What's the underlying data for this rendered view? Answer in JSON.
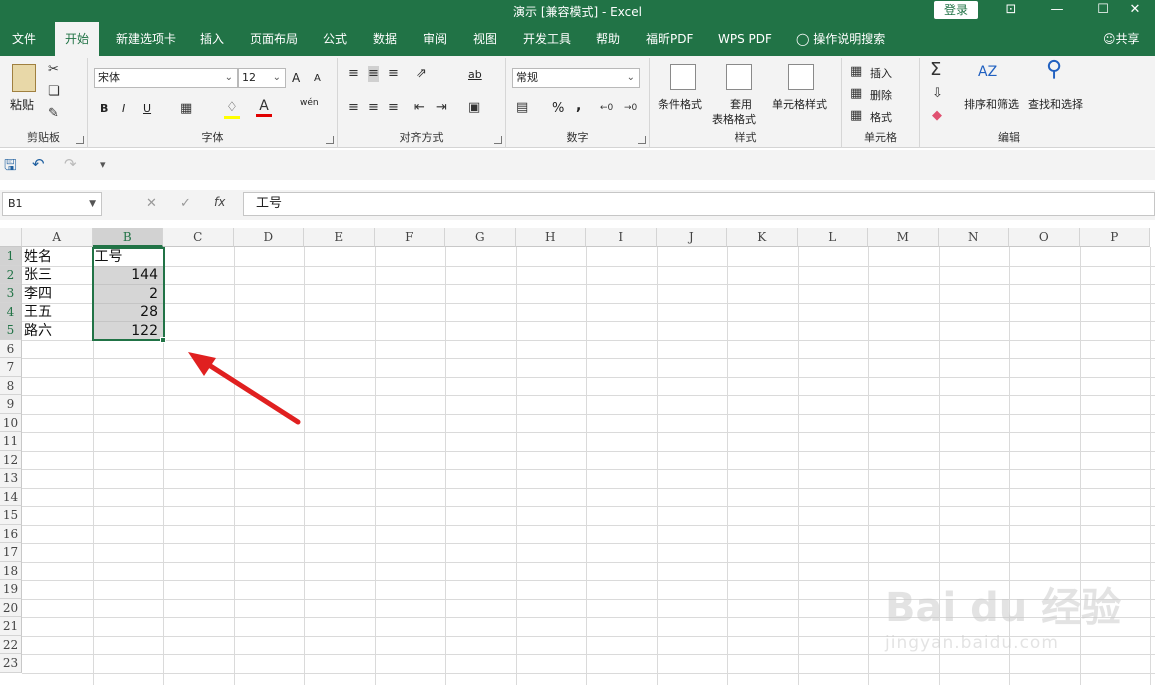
{
  "window": {
    "title": "演示 [兼容模式] - Excel",
    "login": "登录",
    "controls": [
      "⊡",
      "—",
      "☐",
      "✕"
    ]
  },
  "menu": {
    "tabs": [
      "文件",
      "开始",
      "新建选项卡",
      "插入",
      "页面布局",
      "公式",
      "数据",
      "审阅",
      "视图",
      "开发工具",
      "帮助",
      "福昕PDF",
      "WPS PDF"
    ],
    "active": "开始",
    "tell_me": "操作说明搜索",
    "share": "共享"
  },
  "ribbon": {
    "clipboard": {
      "label": "剪贴板",
      "paste": "粘贴"
    },
    "font": {
      "label": "字体",
      "font_name": "宋体",
      "font_size": "12",
      "bold": "B",
      "italic": "I",
      "underline": "U",
      "grow": "A",
      "shrink": "A",
      "wen": "wén"
    },
    "alignment": {
      "label": "对齐方式",
      "wrap": "ab"
    },
    "number": {
      "label": "数字",
      "format": "常规",
      "percent": "%",
      "comma": ","
    },
    "styles": {
      "label": "样式",
      "conditional": "条件格式",
      "table_line1": "套用",
      "table_line2": "表格格式",
      "cell_styles": "单元格样式"
    },
    "cells": {
      "label": "单元格",
      "insert": "插入",
      "delete": "删除",
      "format": "格式"
    },
    "editing": {
      "label": "编辑",
      "sort": "排序和筛选",
      "find": "查找和选择"
    }
  },
  "formula_bar": {
    "name_box": "B1",
    "fx": "fx",
    "content": "工号"
  },
  "sheet": {
    "columns": [
      "A",
      "B",
      "C",
      "D",
      "E",
      "F",
      "G",
      "H",
      "I",
      "J",
      "K",
      "L",
      "M",
      "N",
      "O",
      "P"
    ],
    "rows": [
      "1",
      "2",
      "3",
      "4",
      "5",
      "6",
      "7",
      "8",
      "9",
      "10",
      "11",
      "12",
      "13",
      "14",
      "15",
      "16",
      "17",
      "18",
      "19",
      "20",
      "21",
      "22",
      "23"
    ],
    "cells": {
      "A1": "姓名",
      "B1": "工号",
      "A2": "张三",
      "B2": "144",
      "A3": "李四",
      "B3": "2",
      "A4": "王五",
      "B4": "28",
      "A5": "路六",
      "B5": "122"
    },
    "selection": "B1:B5"
  },
  "watermark": {
    "brand": "Bai du 经验",
    "url": "jingyan.baidu.com"
  },
  "colors": {
    "accent": "#217346",
    "arrow": "#e02020"
  }
}
